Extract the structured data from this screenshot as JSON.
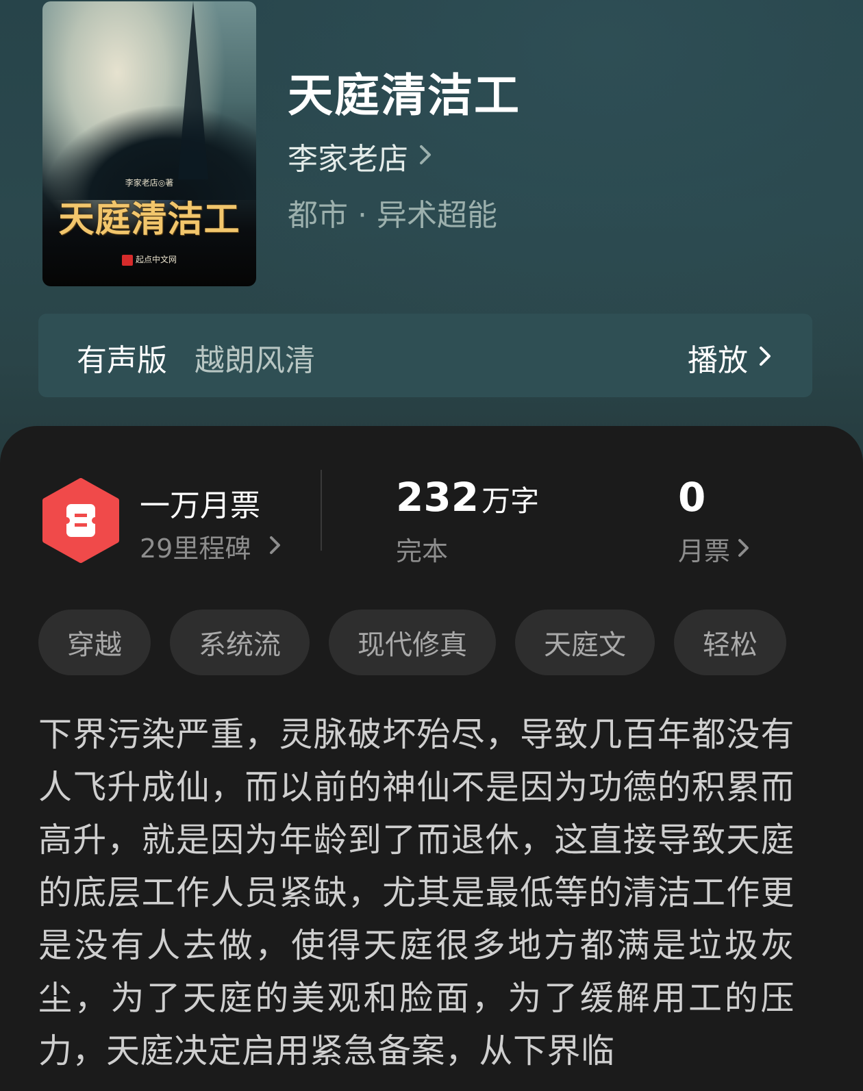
{
  "book": {
    "title": "天庭清洁工",
    "author": "李家老店",
    "category": "都市 · 异术超能",
    "cover": {
      "title": "天庭清洁工",
      "author_line": "李家老店◎著",
      "publisher": "起点中文网"
    }
  },
  "audio": {
    "label": "有声版",
    "narrator": "越朗风清",
    "play_label": "播放"
  },
  "stats": {
    "ticket_title": "一万月票",
    "milestone": "29里程碑",
    "word_count": "232",
    "word_unit": "万字",
    "status": "完本",
    "monthly_votes": "0",
    "monthly_votes_label": "月票"
  },
  "tags": [
    "穿越",
    "系统流",
    "现代修真",
    "天庭文",
    "轻松"
  ],
  "synopsis": "下界污染严重，灵脉破坏殆尽，导致几百年都没有人飞升成仙，而以前的神仙不是因为功德的积累而高升，就是因为年龄到了而退休，这直接导致天庭的底层工作人员紧缺，尤其是最低等的清洁工作更是没有人去做，使得天庭很多地方都满是垃圾灰尘，为了天庭的美观和脸面，为了缓解用工的压力，天庭决定启用紧急备案，从下界临",
  "colors": {
    "accent_red": "#f04a4a",
    "hero_bg": "#2b484d",
    "panel_bg": "#1b1b1b",
    "tag_bg": "#2e2e2e"
  }
}
